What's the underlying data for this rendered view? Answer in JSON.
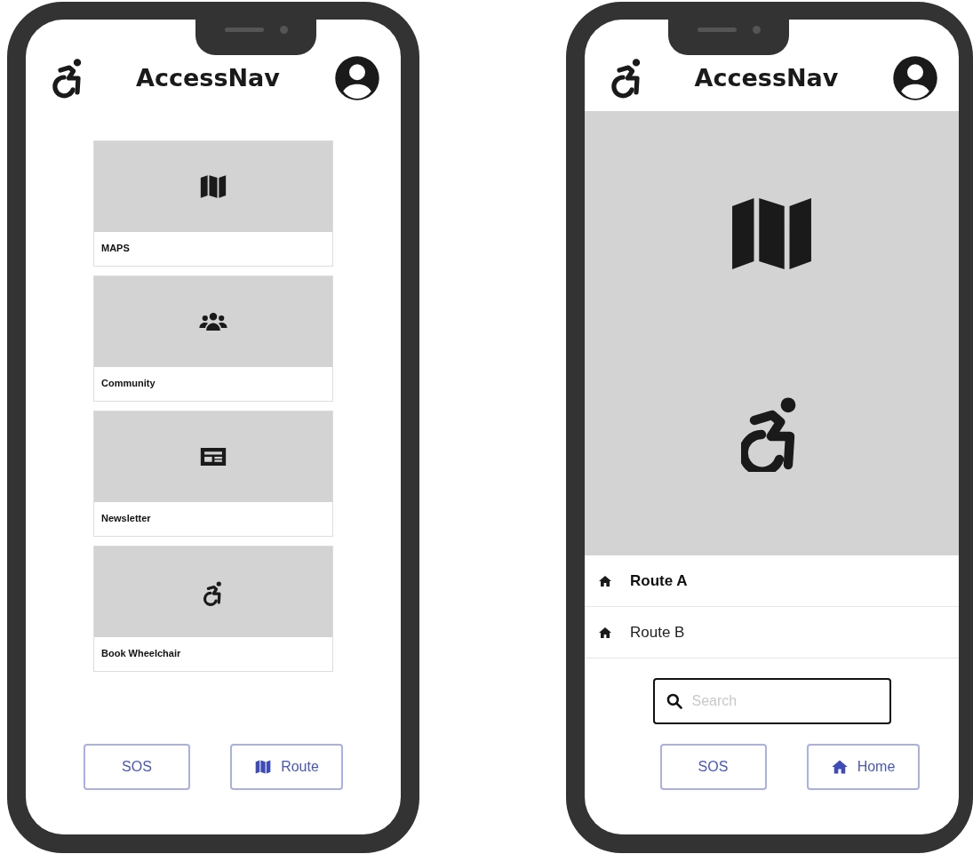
{
  "home_screen": {
    "app_title": "AccessNav",
    "cards": [
      {
        "label": "MAPS"
      },
      {
        "label": "Community"
      },
      {
        "label": "Newsletter"
      },
      {
        "label": "Book Wheelchair"
      }
    ],
    "buttons": [
      {
        "label": "SOS"
      },
      {
        "label": "Route"
      }
    ]
  },
  "route_screen": {
    "app_title": "AccessNav",
    "routes": [
      {
        "label": "Route A",
        "selected": true
      },
      {
        "label": "Route B",
        "selected": false
      }
    ],
    "search": {
      "placeholder": "Search"
    },
    "buttons": [
      {
        "label": "SOS"
      },
      {
        "label": "Home"
      }
    ]
  }
}
